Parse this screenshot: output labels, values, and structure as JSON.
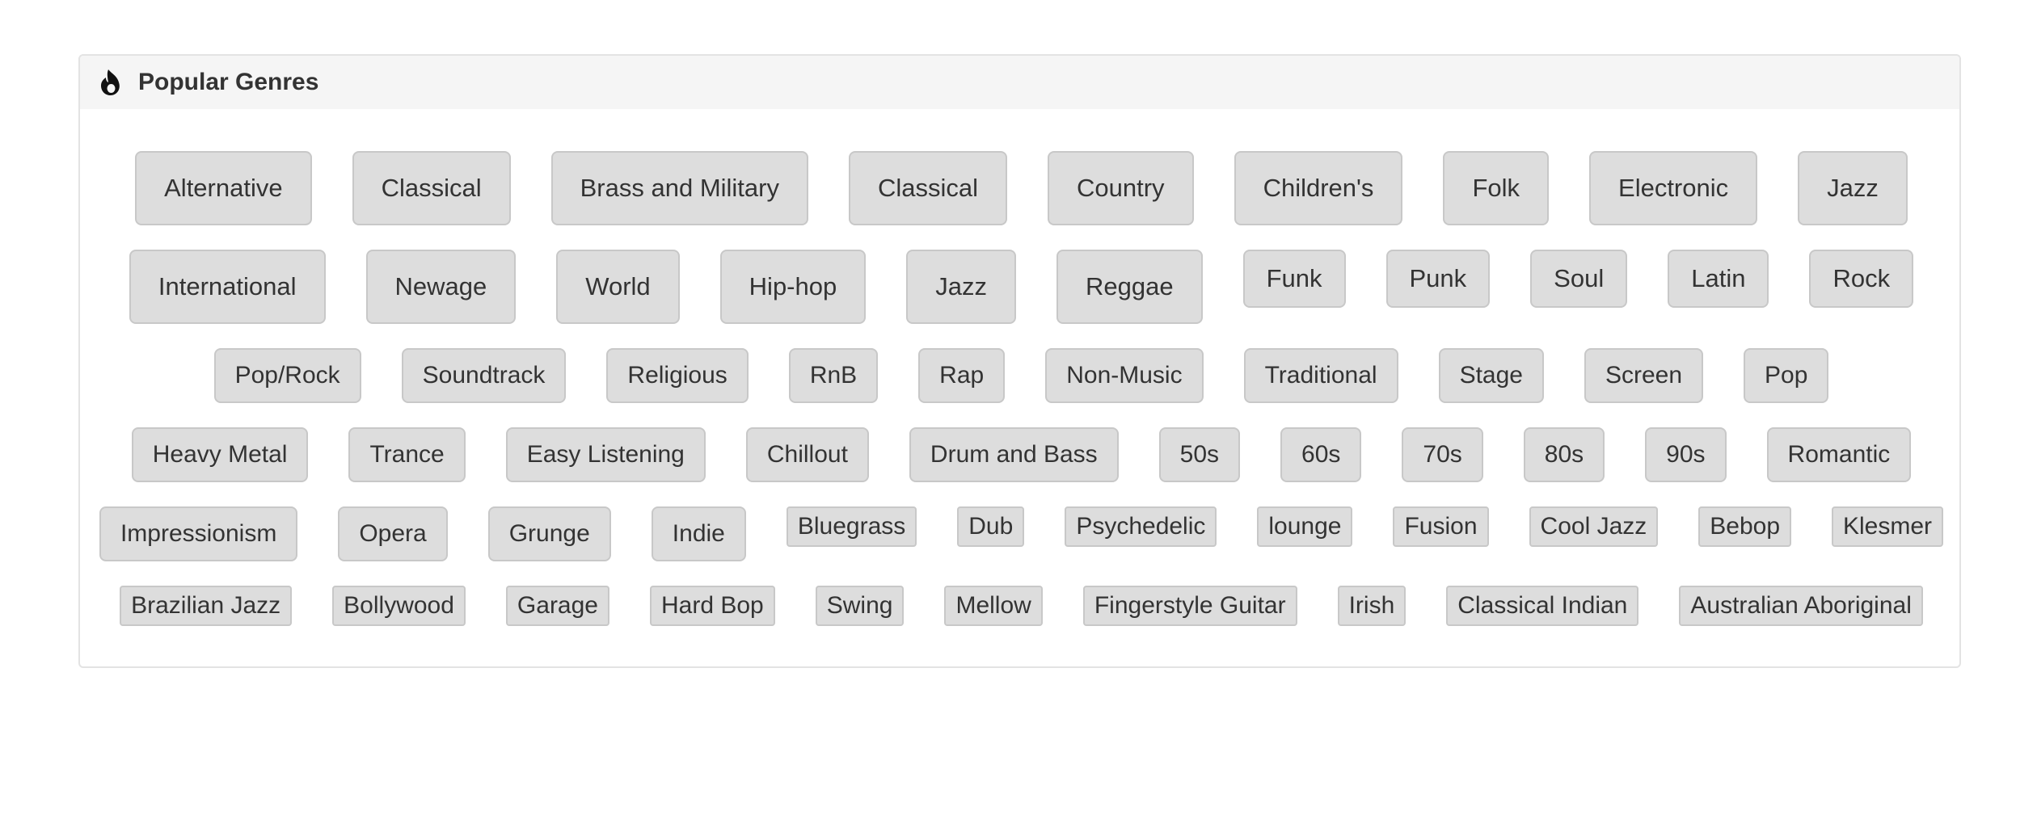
{
  "panel": {
    "title": "Popular Genres",
    "icon": "flame-icon"
  },
  "colors": {
    "tag_bg": "#dddddd",
    "tag_border": "#c8c8c8",
    "header_bg": "#f5f5f5",
    "text": "#333333"
  },
  "rows": [
    [
      {
        "label": "Alternative",
        "size": "xl"
      },
      {
        "label": "Classical",
        "size": "xl"
      },
      {
        "label": "Brass and Military",
        "size": "xl"
      },
      {
        "label": "Classical",
        "size": "xl"
      },
      {
        "label": "Country",
        "size": "xl"
      },
      {
        "label": "Children's",
        "size": "xl"
      },
      {
        "label": "Folk",
        "size": "xl"
      },
      {
        "label": "Electronic",
        "size": "xl"
      },
      {
        "label": "Jazz",
        "size": "xl"
      }
    ],
    [
      {
        "label": "International",
        "size": "xl"
      },
      {
        "label": "Newage",
        "size": "xl"
      },
      {
        "label": "World",
        "size": "xl"
      },
      {
        "label": "Hip-hop",
        "size": "xl"
      },
      {
        "label": "Jazz",
        "size": "xl"
      },
      {
        "label": "Reggae",
        "size": "xl"
      },
      {
        "label": "Funk",
        "size": "l"
      },
      {
        "label": "Punk",
        "size": "l"
      },
      {
        "label": "Soul",
        "size": "l"
      },
      {
        "label": "Latin",
        "size": "l"
      },
      {
        "label": "Rock",
        "size": "l"
      }
    ],
    [
      {
        "label": "Pop/Rock",
        "size": "m"
      },
      {
        "label": "Soundtrack",
        "size": "m"
      },
      {
        "label": "Religious",
        "size": "m"
      },
      {
        "label": "RnB",
        "size": "m"
      },
      {
        "label": "Rap",
        "size": "m"
      },
      {
        "label": "Non-Music",
        "size": "m"
      },
      {
        "label": "Traditional",
        "size": "m"
      },
      {
        "label": "Stage",
        "size": "m"
      },
      {
        "label": "Screen",
        "size": "m"
      },
      {
        "label": "Pop",
        "size": "m"
      }
    ],
    [
      {
        "label": "Heavy Metal",
        "size": "m"
      },
      {
        "label": "Trance",
        "size": "m"
      },
      {
        "label": "Easy Listening",
        "size": "m"
      },
      {
        "label": "Chillout",
        "size": "m"
      },
      {
        "label": "Drum and Bass",
        "size": "m"
      },
      {
        "label": "50s",
        "size": "m"
      },
      {
        "label": "60s",
        "size": "m"
      },
      {
        "label": "70s",
        "size": "m"
      },
      {
        "label": "80s",
        "size": "m"
      },
      {
        "label": "90s",
        "size": "m"
      },
      {
        "label": "Romantic",
        "size": "m"
      }
    ],
    [
      {
        "label": "Impressionism",
        "size": "m"
      },
      {
        "label": "Opera",
        "size": "m"
      },
      {
        "label": "Grunge",
        "size": "m"
      },
      {
        "label": "Indie",
        "size": "m"
      },
      {
        "label": "Bluegrass",
        "size": "xs"
      },
      {
        "label": "Dub",
        "size": "xs"
      },
      {
        "label": "Psychedelic",
        "size": "xs"
      },
      {
        "label": "lounge",
        "size": "xs"
      },
      {
        "label": "Fusion",
        "size": "xs"
      },
      {
        "label": "Cool Jazz",
        "size": "xs"
      },
      {
        "label": "Bebop",
        "size": "xs"
      },
      {
        "label": "Klesmer",
        "size": "xs"
      }
    ],
    [
      {
        "label": "Brazilian Jazz",
        "size": "xs"
      },
      {
        "label": "Bollywood",
        "size": "xs"
      },
      {
        "label": "Garage",
        "size": "xs"
      },
      {
        "label": "Hard Bop",
        "size": "xs"
      },
      {
        "label": "Swing",
        "size": "xs"
      },
      {
        "label": "Mellow",
        "size": "xs"
      },
      {
        "label": "Fingerstyle Guitar",
        "size": "xs"
      },
      {
        "label": "Irish",
        "size": "xs"
      },
      {
        "label": "Classical Indian",
        "size": "xs"
      },
      {
        "label": "Australian Aboriginal",
        "size": "xs"
      }
    ]
  ]
}
